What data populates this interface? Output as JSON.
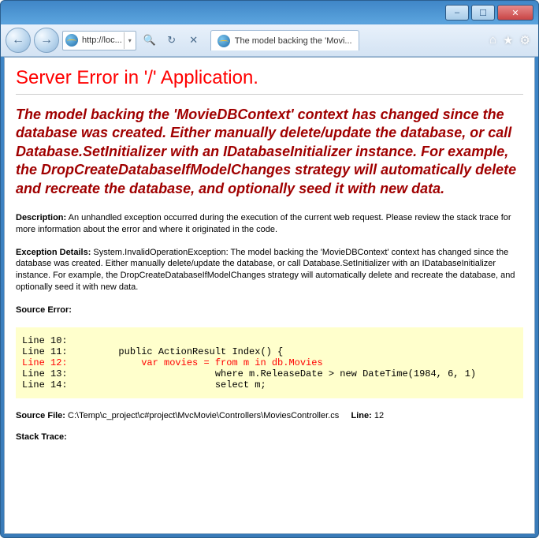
{
  "window": {
    "address_text": "http://loc...",
    "tab_title": "The model backing the 'Movi..."
  },
  "error": {
    "heading": "Server Error in '/' Application.",
    "message": "The model backing the 'MovieDBContext' context has changed since the database was created. Either manually delete/update the database, or call Database.SetInitializer with an IDatabaseInitializer instance. For example, the DropCreateDatabaseIfModelChanges strategy will automatically delete and recreate the database, and optionally seed it with new data.",
    "description_label": "Description:",
    "description_text": "An unhandled exception occurred during the execution of the current web request. Please review the stack trace for more information about the error and where it originated in the code.",
    "exception_label": "Exception Details:",
    "exception_text": "System.InvalidOperationException: The model backing the 'MovieDBContext' context has changed since the database was created. Either manually delete/update the database, or call Database.SetInitializer with an IDatabaseInitializer instance. For example, the DropCreateDatabaseIfModelChanges strategy will automatically delete and recreate the database, and optionally seed it with new data.",
    "source_error_label": "Source Error:",
    "code": {
      "l10": "Line 10:",
      "l11": "Line 11:         public ActionResult Index() {",
      "l12": "Line 12:             var movies = from m in db.Movies",
      "l13": "Line 13:                          where m.ReleaseDate > new DateTime(1984, 6, 1)",
      "l14": "Line 14:                          select m;"
    },
    "source_file_label": "Source File:",
    "source_file_path": "C:\\Temp\\c_project\\c#project\\MvcMovie\\Controllers\\MoviesController.cs",
    "line_label": "Line:",
    "line_number": "12",
    "stack_trace_label": "Stack Trace:"
  }
}
